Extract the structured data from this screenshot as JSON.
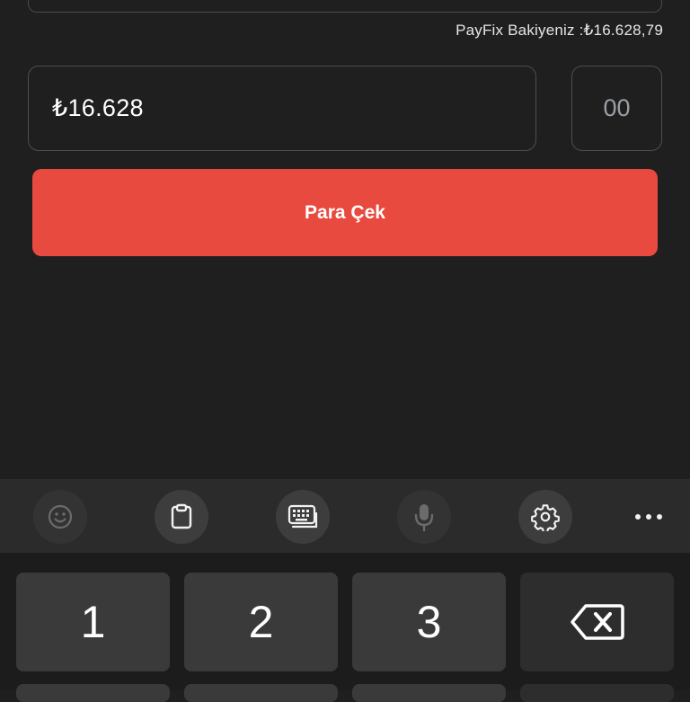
{
  "balance": {
    "text": "PayFix Bakiyeniz :₺16.628,79"
  },
  "amount": {
    "value": "₺16.628",
    "cents": "00"
  },
  "withdraw_button": {
    "label": "Para Çek"
  },
  "keyboard": {
    "toolbar": [
      "emoji-icon",
      "clipboard-icon",
      "keyboard-layout-icon",
      "microphone-icon",
      "settings-icon",
      "more-icon"
    ],
    "keys": {
      "k1": "1",
      "k2": "2",
      "k3": "3"
    }
  },
  "colors": {
    "accent": "#e84a3f",
    "background": "#1f1f1f"
  }
}
